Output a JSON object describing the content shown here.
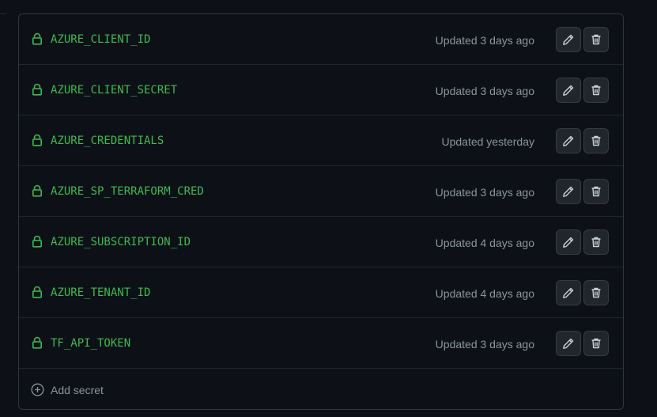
{
  "secrets": [
    {
      "name": "AZURE_CLIENT_ID",
      "updated": "Updated 3 days ago"
    },
    {
      "name": "AZURE_CLIENT_SECRET",
      "updated": "Updated 3 days ago"
    },
    {
      "name": "AZURE_CREDENTIALS",
      "updated": "Updated yesterday"
    },
    {
      "name": "AZURE_SP_TERRAFORM_CRED",
      "updated": "Updated 3 days ago"
    },
    {
      "name": "AZURE_SUBSCRIPTION_ID",
      "updated": "Updated 4 days ago"
    },
    {
      "name": "AZURE_TENANT_ID",
      "updated": "Updated 4 days ago"
    },
    {
      "name": "TF_API_TOKEN",
      "updated": "Updated 3 days ago"
    }
  ],
  "add_secret": {
    "label": "Add secret",
    "icon": "plus-circle-icon"
  },
  "icons": {
    "row": "lock-icon",
    "edit": "pencil-icon",
    "delete": "trash-icon"
  },
  "colors": {
    "background": "#0d1117",
    "secret_name": "#3fb950",
    "muted_text": "#8b949e",
    "button_bg": "#21262d",
    "border": "#30363d"
  }
}
